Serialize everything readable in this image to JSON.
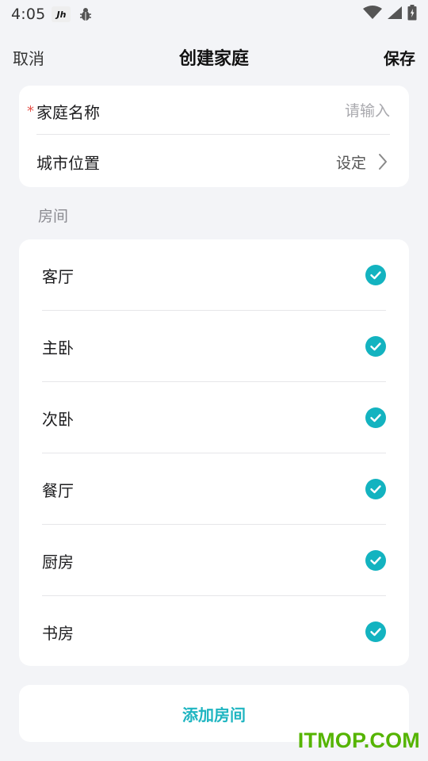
{
  "status_bar": {
    "time": "4:05",
    "app_badge": "Jh",
    "icons": [
      "bug-icon",
      "wifi-icon",
      "signal-icon",
      "battery-icon"
    ]
  },
  "header": {
    "cancel_label": "取消",
    "title": "创建家庭",
    "save_label": "保存"
  },
  "family": {
    "name_label": "家庭名称",
    "name_required_mark": "*",
    "name_value": "",
    "name_placeholder": "请输入",
    "city_label": "城市位置",
    "city_value": "设定"
  },
  "rooms": {
    "section_label": "房间",
    "items": [
      {
        "name": "客厅",
        "checked": true
      },
      {
        "name": "主卧",
        "checked": true
      },
      {
        "name": "次卧",
        "checked": true
      },
      {
        "name": "餐厅",
        "checked": true
      },
      {
        "name": "厨房",
        "checked": true
      },
      {
        "name": "书房",
        "checked": true
      }
    ],
    "add_label": "添加房间"
  },
  "colors": {
    "accent": "#1fb5c1",
    "check": "#13b3c0",
    "required": "#e5544b",
    "background": "#f3f4f7"
  },
  "watermark": "ITMOP.COM"
}
